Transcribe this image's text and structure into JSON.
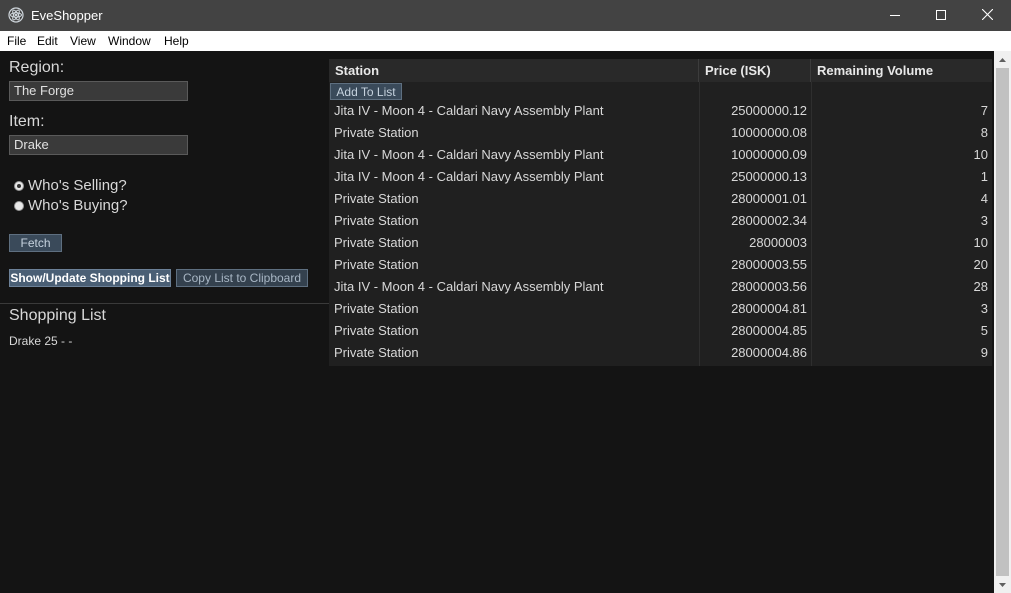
{
  "window": {
    "title": "EveShopper"
  },
  "menu": {
    "items": [
      "File",
      "Edit",
      "View",
      "Window",
      "Help"
    ]
  },
  "form": {
    "region_label": "Region:",
    "region_value": "The Forge",
    "item_label": "Item:",
    "item_value": "Drake",
    "radio_selling": "Who's Selling?",
    "radio_buying": "Who's Buying?",
    "fetch_label": "Fetch",
    "show_update_label": "Show/Update Shopping List",
    "copy_label": "Copy List to Clipboard"
  },
  "shopping_list": {
    "title": "Shopping List",
    "lines": [
      "Drake 25 - -"
    ]
  },
  "table": {
    "headers": {
      "station": "Station",
      "price": "Price (ISK)",
      "volume": "Remaining Volume"
    },
    "add_to_list_label": "Add To List",
    "rows": [
      {
        "station": "Jita IV - Moon 4 - Caldari Navy Assembly Plant",
        "price": "25000000.12",
        "volume": "7"
      },
      {
        "station": "Private Station",
        "price": "10000000.08",
        "volume": "8"
      },
      {
        "station": "Jita IV - Moon 4 - Caldari Navy Assembly Plant",
        "price": "10000000.09",
        "volume": "10"
      },
      {
        "station": "Jita IV - Moon 4 - Caldari Navy Assembly Plant",
        "price": "25000000.13",
        "volume": "1"
      },
      {
        "station": "Private Station",
        "price": "28000001.01",
        "volume": "4"
      },
      {
        "station": "Private Station",
        "price": "28000002.34",
        "volume": "3"
      },
      {
        "station": "Private Station",
        "price": "28000003",
        "volume": "10"
      },
      {
        "station": "Private Station",
        "price": "28000003.55",
        "volume": "20"
      },
      {
        "station": "Jita IV - Moon 4 - Caldari Navy Assembly Plant",
        "price": "28000003.56",
        "volume": "28"
      },
      {
        "station": "Private Station",
        "price": "28000004.81",
        "volume": "3"
      },
      {
        "station": "Private Station",
        "price": "28000004.85",
        "volume": "5"
      },
      {
        "station": "Private Station",
        "price": "28000004.86",
        "volume": "9"
      }
    ]
  },
  "icons": {
    "app": "electron-app-icon",
    "minimize": "minimize-icon",
    "maximize": "maximize-icon",
    "close": "close-icon"
  },
  "colors": {
    "titlebar": "#434343",
    "background": "#141414",
    "table": "#202020",
    "button": "#3a4a5a"
  }
}
